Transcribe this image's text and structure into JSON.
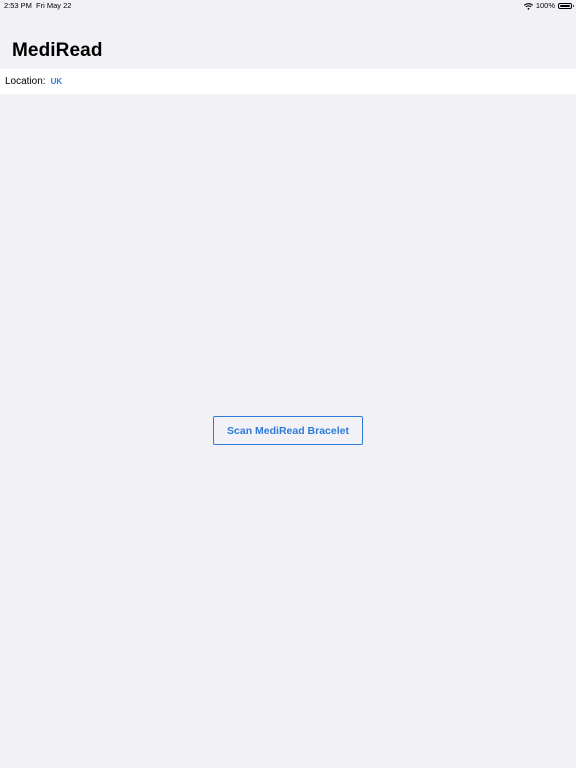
{
  "status_bar": {
    "time": "2:53 PM",
    "date": "Fri May 22",
    "battery_percent": "100%",
    "battery_level": 1.0,
    "icons": [
      "wifi-icon",
      "battery-icon"
    ]
  },
  "nav": {
    "title": "MediRead"
  },
  "location": {
    "label": "Location:",
    "value": "UK"
  },
  "main": {
    "scan_button_label": "Scan MediRead Bracelet"
  },
  "colors": {
    "background": "#f1f1f6",
    "accent": "#2f7bd8",
    "row_background": "#ffffff"
  }
}
